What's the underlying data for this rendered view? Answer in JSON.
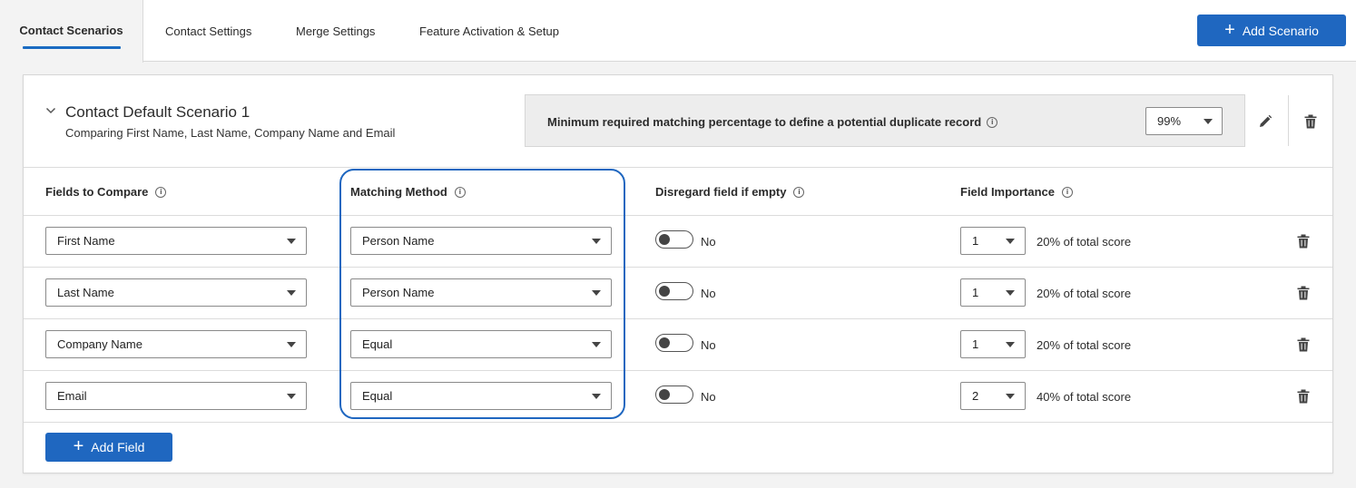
{
  "tabs": [
    {
      "label": "Contact Scenarios",
      "active": true
    },
    {
      "label": "Contact Settings",
      "active": false
    },
    {
      "label": "Merge Settings",
      "active": false
    },
    {
      "label": "Feature Activation & Setup",
      "active": false
    }
  ],
  "add_scenario_label": "Add Scenario",
  "scenario": {
    "title": "Contact Default Scenario 1",
    "subtitle": "Comparing First Name, Last Name, Company Name and Email",
    "threshold_label": "Minimum required matching percentage to define a potential duplicate record",
    "threshold_value": "99%"
  },
  "columns": {
    "fields": "Fields to Compare",
    "method": "Matching Method",
    "disregard": "Disregard field if empty",
    "importance": "Field Importance"
  },
  "rows": [
    {
      "field": "First Name",
      "method": "Person Name",
      "disregard": "No",
      "importance": "1",
      "score": "20% of total score"
    },
    {
      "field": "Last Name",
      "method": "Person Name",
      "disregard": "No",
      "importance": "1",
      "score": "20% of total score"
    },
    {
      "field": "Company Name",
      "method": "Equal",
      "disregard": "No",
      "importance": "1",
      "score": "20% of total score"
    },
    {
      "field": "Email",
      "method": "Equal",
      "disregard": "No",
      "importance": "2",
      "score": "40% of total score"
    }
  ],
  "add_field_label": "Add Field",
  "colors": {
    "primary": "#1f67c0",
    "highlight": "#1f67c0",
    "panel": "#ededed"
  },
  "icons": [
    "chevron-down-icon",
    "info-icon",
    "pencil-icon",
    "trash-icon",
    "plus-icon",
    "caret-down-icon"
  ]
}
